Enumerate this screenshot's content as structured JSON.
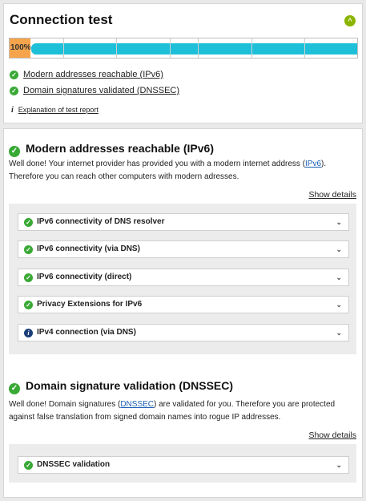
{
  "header": {
    "title": "Connection test",
    "progress_label": "100%"
  },
  "summary": [
    {
      "label": "Modern addresses reachable (IPv6)"
    },
    {
      "label": "Domain signatures validated (DNSSEC)"
    }
  ],
  "explanation_link": "Explanation of test report",
  "ipv6": {
    "title": "Modern addresses reachable (IPv6)",
    "text_before": "Well done! Your internet provider has provided you with a modern internet address (",
    "link": "IPv6",
    "text_after": "). Therefore you can reach other computers with modern adresses.",
    "show_details": "Show details",
    "items": [
      {
        "label": "IPv6 connectivity of DNS resolver",
        "status": "ok"
      },
      {
        "label": "IPv6 connectivity (via DNS)",
        "status": "ok"
      },
      {
        "label": "IPv6 connectivity (direct)",
        "status": "ok"
      },
      {
        "label": "Privacy Extensions for IPv6",
        "status": "ok"
      },
      {
        "label": "IPv4 connection (via DNS)",
        "status": "info"
      }
    ]
  },
  "dnssec": {
    "title": "Domain signature validation (DNSSEC)",
    "text_before": "Well done! Domain signatures (",
    "link": "DNSSEC",
    "text_after": ") are validated for you. Therefore you are protected against false translation from signed domain names into rogue IP addresses.",
    "show_details": "Show details",
    "items": [
      {
        "label": "DNSSEC validation",
        "status": "ok"
      }
    ]
  },
  "colors": {
    "success": "#39a935",
    "progress_fill": "#1ec0d9",
    "progress_lead": "#f5a44c",
    "link": "#1a5fb4",
    "info": "#1c3f7a"
  },
  "icons": {
    "collapse": "chevron-up-icon",
    "ok": "check-circle-icon",
    "info": "info-circle-icon",
    "expand": "chevron-down-icon"
  }
}
